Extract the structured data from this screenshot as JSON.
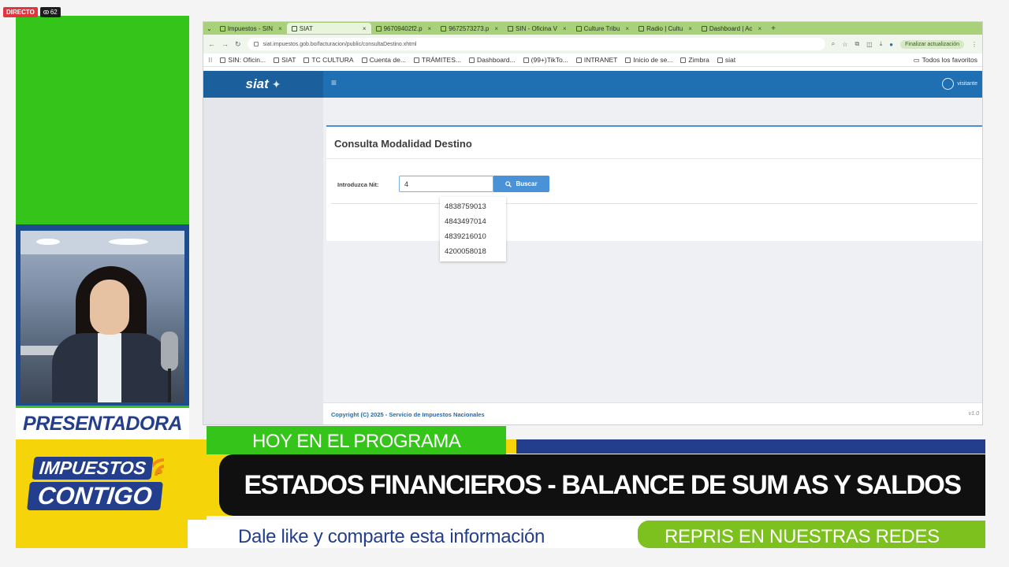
{
  "overlay": {
    "live_label": "DIRECTO",
    "viewer_count": "62"
  },
  "presenter": {
    "label": "PRESENTADORA"
  },
  "logo": {
    "line1": "IMPUESTOS",
    "line2": "CONTIGO"
  },
  "browser": {
    "tabs": [
      {
        "label": "Impuestos - SIN"
      },
      {
        "label": "SIAT",
        "active": true
      },
      {
        "label": "96709402f2.p"
      },
      {
        "label": "9672573273.p"
      },
      {
        "label": "SIN - Oficina V"
      },
      {
        "label": "Culture Tribu"
      },
      {
        "label": "Radio | Cultu"
      },
      {
        "label": "Dashboard | Ac"
      }
    ],
    "url": "siat.impuestos.gob.bo/facturacion/public/consultaDestino.xhtml",
    "update_label": "Finalizar actualización",
    "bookmarks": [
      "SIN: Oficin...",
      "SIAT",
      "TC CULTURA",
      "Cuenta de...",
      "TRÁMITES...",
      "Dashboard...",
      "(99+)TikTo...",
      "INTRANET",
      "Inicio de se...",
      "Zimbra",
      "siat"
    ],
    "bookmarks_all": "Todos los favoritos"
  },
  "siat": {
    "logo_text": "siat",
    "user_label": "visitante",
    "card_title": "Consulta Modalidad Destino",
    "nit_label": "Introduzca Nit:",
    "nit_value": "4",
    "search_label": "Buscar",
    "suggestions": [
      "4838759013",
      "4843497014",
      "4839216010",
      "4200058018"
    ],
    "footer": "Copyright (C) 2025 - Servicio de Impuestos Nacionales",
    "version": "v1.0"
  },
  "banner": {
    "today": "HOY EN EL PROGRAMA",
    "title": "ESTADOS FINANCIEROS - BALANCE DE SUM AS Y SALDOS",
    "like": "Dale like y comparte esta información",
    "repris": "REPRIS EN NUESTRAS REDES"
  },
  "colors": {
    "green": "#35c419",
    "yellow": "#f5d50a",
    "navy": "#233e8c",
    "siat_blue": "#1f6fb3"
  }
}
